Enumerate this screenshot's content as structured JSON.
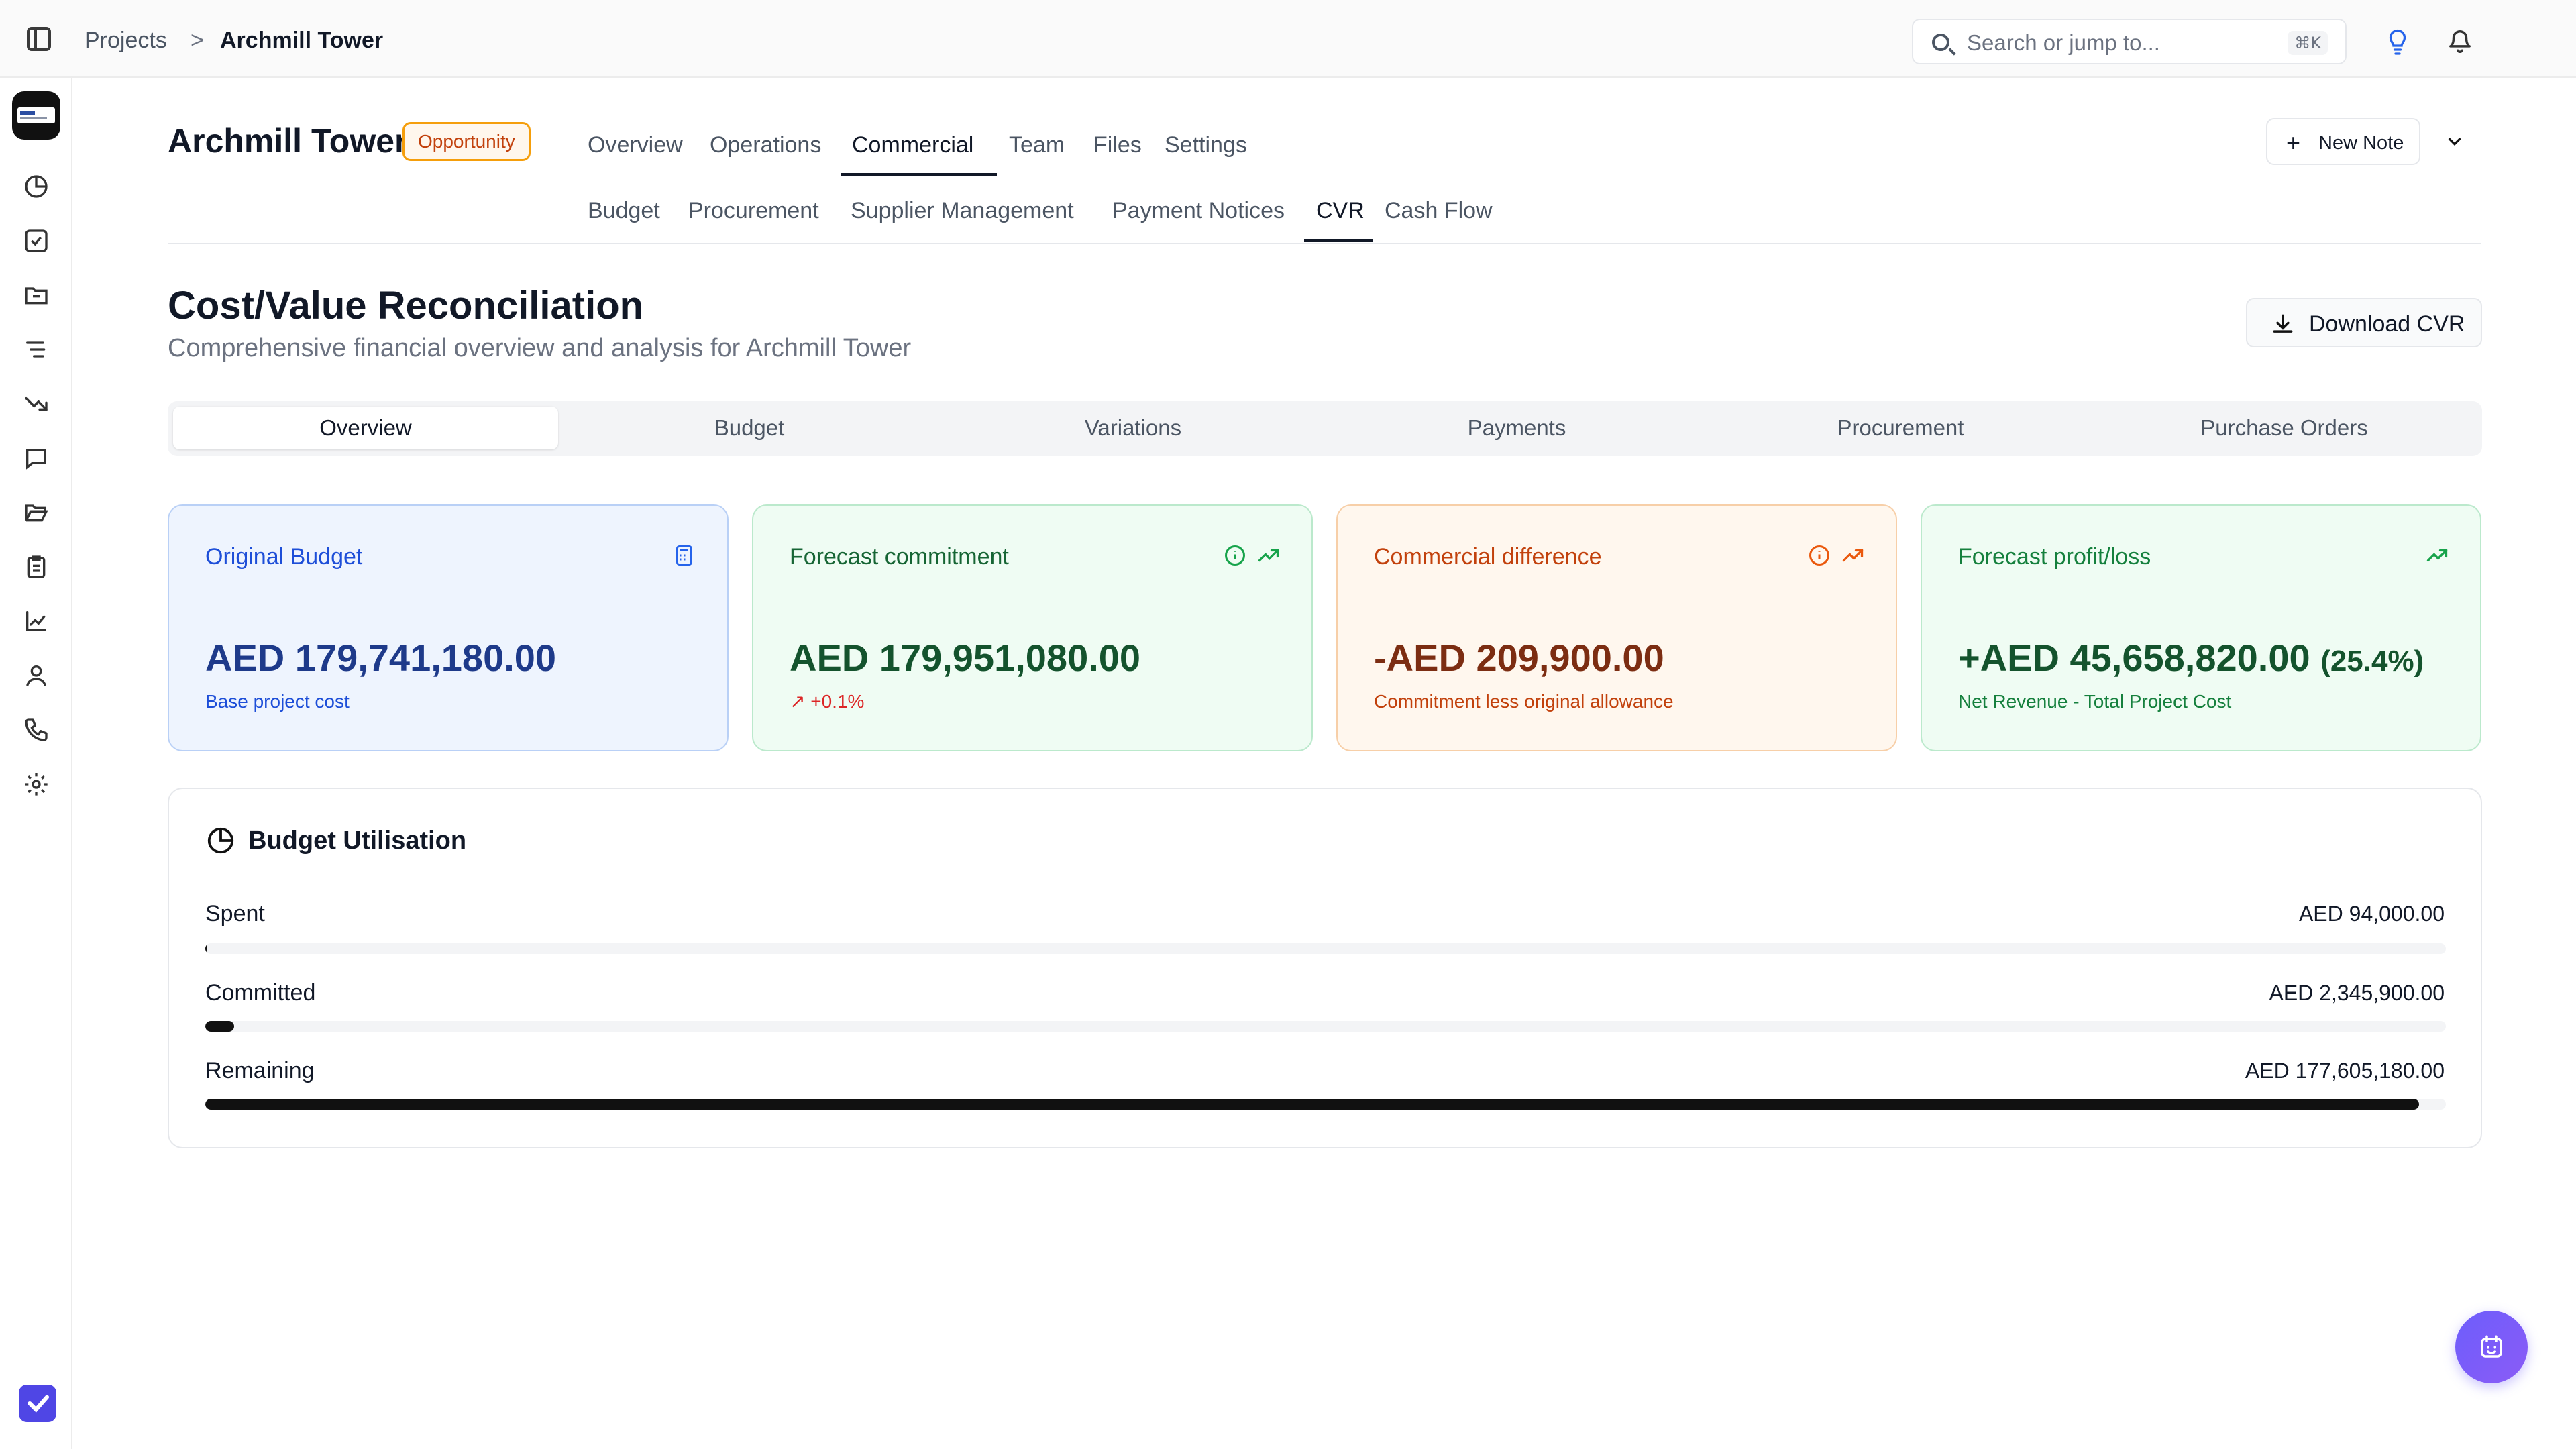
{
  "breadcrumb": {
    "root": "Projects",
    "separator": ">",
    "current": "Archmill Tower"
  },
  "search": {
    "placeholder": "Search or jump to...",
    "shortcut": "⌘K"
  },
  "project": {
    "title": "Archmill Tower",
    "status": "Opportunity"
  },
  "main_tabs": [
    {
      "label": "Overview"
    },
    {
      "label": "Operations"
    },
    {
      "label": "Commercial",
      "active": true
    },
    {
      "label": "Team"
    },
    {
      "label": "Files"
    },
    {
      "label": "Settings"
    }
  ],
  "sub_tabs": [
    {
      "label": "Budget"
    },
    {
      "label": "Procurement"
    },
    {
      "label": "Supplier Management"
    },
    {
      "label": "Payment Notices"
    },
    {
      "label": "CVR",
      "active": true
    },
    {
      "label": "Cash Flow"
    }
  ],
  "actions": {
    "new_note": "New Note",
    "download": "Download CVR"
  },
  "page": {
    "title": "Cost/Value Reconciliation",
    "subtitle": "Comprehensive financial overview and analysis for Archmill Tower"
  },
  "segments": [
    {
      "label": "Overview",
      "active": true
    },
    {
      "label": "Budget"
    },
    {
      "label": "Variations"
    },
    {
      "label": "Payments"
    },
    {
      "label": "Procurement"
    },
    {
      "label": "Purchase Orders"
    }
  ],
  "cards": {
    "original_budget": {
      "title": "Original Budget",
      "value": "AED 179,741,180.00",
      "note": "Base project cost",
      "icon": "calculator-icon"
    },
    "forecast_commitment": {
      "title": "Forecast commitment",
      "value": "AED 179,951,080.00",
      "note": "↗ +0.1%",
      "icons": [
        "info-icon",
        "trend-up-icon"
      ]
    },
    "commercial_difference": {
      "title": "Commercial difference",
      "value": "-AED 209,900.00",
      "note": "Commitment less original allowance",
      "icons": [
        "info-icon",
        "trend-up-icon"
      ]
    },
    "forecast_profit": {
      "title": "Forecast profit/loss",
      "value": "+AED 45,658,820.00",
      "percent": "(25.4%)",
      "note": "Net Revenue - Total Project Cost",
      "icon": "trend-up-icon"
    }
  },
  "utilisation": {
    "title": "Budget Utilisation",
    "rows": [
      {
        "label": "Spent",
        "value": "AED 94,000.00",
        "fraction": 0.0005
      },
      {
        "label": "Committed",
        "value": "AED 2,345,900.00",
        "fraction": 0.013
      },
      {
        "label": "Remaining",
        "value": "AED 177,605,180.00",
        "fraction": 0.988
      }
    ]
  },
  "colors": {
    "accent": "#111827",
    "fab": "#6d5dfc",
    "rail_check": "#4f46e5"
  }
}
